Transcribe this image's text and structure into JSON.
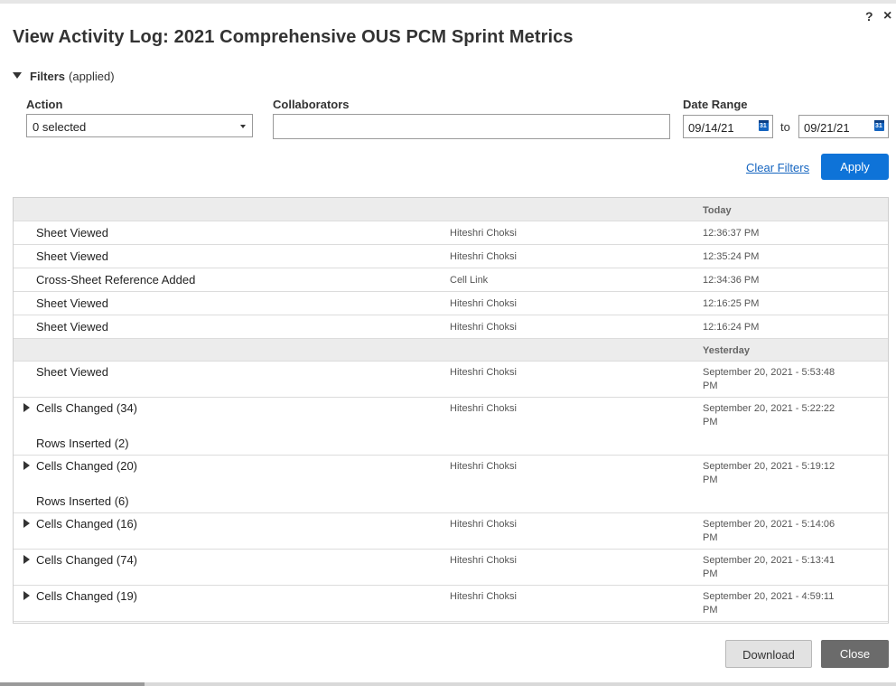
{
  "dialog": {
    "title": "View Activity Log: 2021 Comprehensive OUS PCM Sprint Metrics",
    "help_label": "?",
    "close_label": "×"
  },
  "filters": {
    "toggle_label": "Filters",
    "toggle_status": "(applied)",
    "action_label": "Action",
    "action_value": "0 selected",
    "collaborators_label": "Collaborators",
    "collaborators_value": "",
    "date_range_label": "Date Range",
    "date_from": "09/14/21",
    "date_to": "09/21/21",
    "to_label": "to",
    "calendar_icon_text": "31",
    "clear_label": "Clear Filters",
    "apply_label": "Apply"
  },
  "log": {
    "groups": [
      {
        "header": "Today",
        "entries": [
          {
            "action": "Sheet Viewed",
            "collaborator": "Hiteshri Choksi",
            "time": "12:36:37 PM"
          },
          {
            "action": "Sheet Viewed",
            "collaborator": "Hiteshri Choksi",
            "time": "12:35:24 PM"
          },
          {
            "action": "Cross-Sheet Reference Added",
            "collaborator": "Cell Link",
            "time": "12:34:36 PM"
          },
          {
            "action": "Sheet Viewed",
            "collaborator": "Hiteshri Choksi",
            "time": "12:16:25 PM"
          },
          {
            "action": "Sheet Viewed",
            "collaborator": "Hiteshri Choksi",
            "time": "12:16:24 PM"
          }
        ]
      },
      {
        "header": "Yesterday",
        "entries": [
          {
            "action": "Sheet Viewed",
            "collaborator": "Hiteshri Choksi",
            "time_line1": "September 20, 2021 - 5:53:48",
            "time_line2": "PM"
          },
          {
            "action": "Cells Changed (34)",
            "action2": "Rows Inserted (2)",
            "collaborator": "Hiteshri Choksi",
            "time_line1": "September 20, 2021 - 5:22:22",
            "time_line2": "PM"
          },
          {
            "action": "Cells Changed (20)",
            "action2": "Rows Inserted (6)",
            "collaborator": "Hiteshri Choksi",
            "time_line1": "September 20, 2021 - 5:19:12",
            "time_line2": "PM"
          },
          {
            "action": "Cells Changed (16)",
            "collaborator": "Hiteshri Choksi",
            "time_line1": "September 20, 2021 - 5:14:06",
            "time_line2": "PM"
          },
          {
            "action": "Cells Changed (74)",
            "collaborator": "Hiteshri Choksi",
            "time_line1": "September 20, 2021 - 5:13:41",
            "time_line2": "PM"
          },
          {
            "action": "Cells Changed (19)",
            "collaborator": "Hiteshri Choksi",
            "time_line1": "September 20, 2021 - 4:59:11",
            "time_line2": "PM"
          }
        ]
      }
    ]
  },
  "footer": {
    "download_label": "Download",
    "close_label": "Close"
  }
}
